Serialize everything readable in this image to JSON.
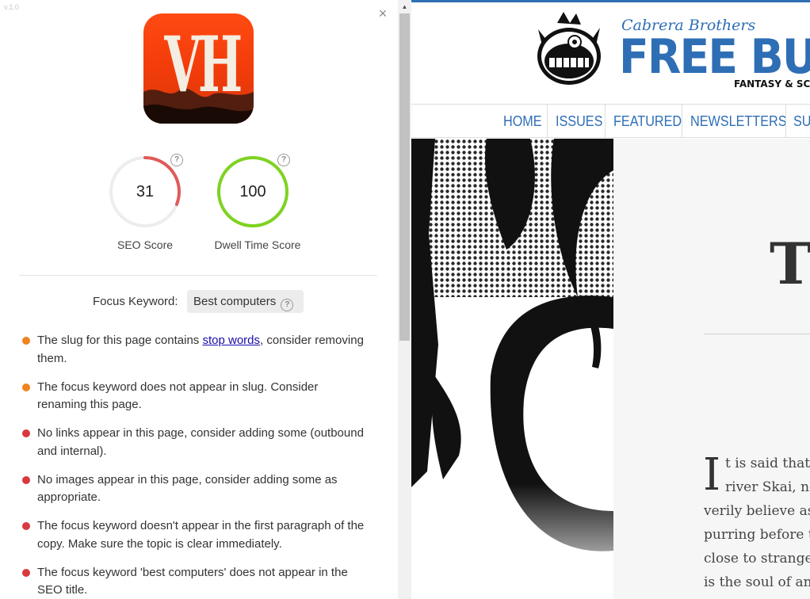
{
  "panel": {
    "version": "v.1.0",
    "close_label": "×",
    "logo_letters": "VH",
    "scores": [
      {
        "label": "SEO Score",
        "value": "31",
        "percent": 31,
        "color": "#e05a5a"
      },
      {
        "label": "Dwell Time Score",
        "value": "100",
        "percent": 100,
        "color": "#7ed321"
      }
    ],
    "help_glyph": "?",
    "focus_keyword": {
      "label": "Focus Keyword:",
      "value": "Best computers"
    },
    "issues": [
      {
        "severity": "warning",
        "color": "#f0831e",
        "pre": "The slug for this page contains ",
        "link": "stop words",
        "post": ", consider removing them."
      },
      {
        "severity": "warning",
        "color": "#f0831e",
        "text": "The focus keyword does not appear in slug. Consider renaming this page."
      },
      {
        "severity": "error",
        "color": "#d9383f",
        "text": "No links appear in this page, consider adding some (outbound and internal)."
      },
      {
        "severity": "error",
        "color": "#d9383f",
        "text": "No images appear in this page, consider adding some as appropriate."
      },
      {
        "severity": "error",
        "color": "#d9383f",
        "text": "The focus keyword doesn't appear in the first paragraph of the copy. Make sure the topic is clear immediately."
      },
      {
        "severity": "error",
        "color": "#d9383f",
        "text": "The focus keyword 'best computers' does not appear in the SEO title."
      }
    ]
  },
  "site": {
    "brand_top": "Cabrera Brothers",
    "brand_main": "FREE BUN",
    "brand_sub": "FANTASY & SC",
    "nav": [
      "HOME",
      "ISSUES",
      "FEATURED",
      "NEWSLETTERS",
      "SU"
    ],
    "title_fragment": "T",
    "drop_cap": "I",
    "story_lines": [
      "t is said that i",
      "river Skai, no",
      "verily believe as",
      "purring before th",
      "close to strange",
      "is the soul of ant"
    ],
    "accent": "#2e6eb5"
  }
}
